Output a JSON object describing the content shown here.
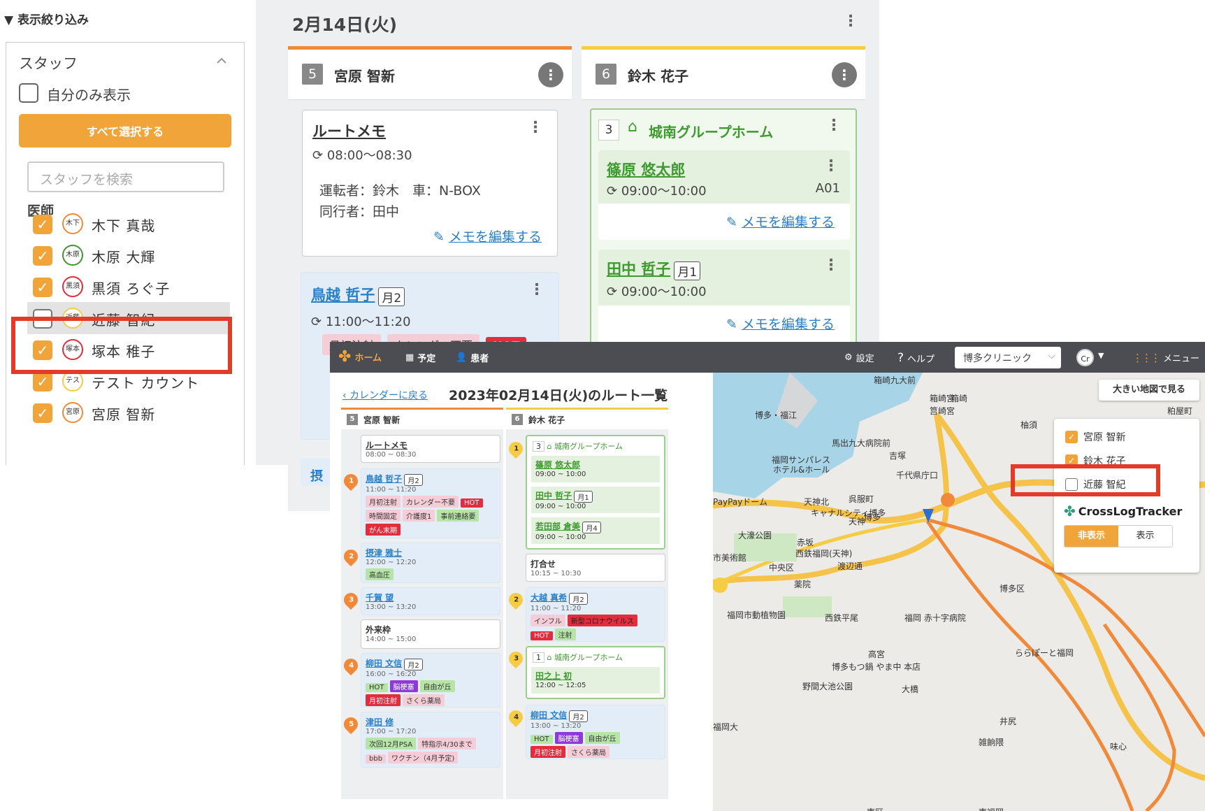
{
  "filter": {
    "header": "▼ 表示絞り込み",
    "section_title": "スタッフ",
    "self_only_label": "自分のみ表示",
    "select_all_label": "すべて選択する",
    "search_placeholder": "スタッフを検索",
    "group_label": "医師",
    "staff": [
      {
        "avatar": "木下",
        "name": "木下 真哉",
        "checked": true,
        "color": "#f08a3a"
      },
      {
        "avatar": "木原",
        "name": "木原 大輝",
        "checked": true,
        "color": "#3d9a2e"
      },
      {
        "avatar": "黒須",
        "name": "黒須 ろぐ子",
        "checked": true,
        "color": "#e32c3c"
      },
      {
        "avatar": "近藤",
        "name": "近藤 智紀",
        "checked": false,
        "color": "#f5cc44"
      },
      {
        "avatar": "塚本",
        "name": "塚本 稚子",
        "checked": true,
        "color": "#e32c3c"
      },
      {
        "avatar": "テス",
        "name": "テスト カウント",
        "checked": true,
        "color": "#f5cc44"
      },
      {
        "avatar": "宮原",
        "name": "宮原 智新",
        "checked": true,
        "color": "#f08a3a"
      }
    ]
  },
  "schedule": {
    "date_title": "2月14日(火)",
    "columns": [
      {
        "number": "5",
        "name": "宮原 智新",
        "accent": "#f08a3a"
      },
      {
        "number": "6",
        "name": "鈴木 花子",
        "accent": "#f5cc44"
      }
    ],
    "route_memo": {
      "title": "ルートメモ",
      "time": "08:00〜08:30",
      "driver_line": "運転者：鈴木　車：N-BOX",
      "companion_line": "同行者：田中",
      "edit_link": "メモを編集する"
    },
    "patient1": {
      "name": "鳥越 哲子",
      "badge": "月2",
      "time": "11:00〜11:20",
      "tags": [
        "月初注射",
        "カレンダー不要",
        "HOT"
      ]
    },
    "group_home": {
      "count": "3",
      "title": "城南グループホーム",
      "p1_name": "篠原 悠太郎",
      "p1_time": "09:00〜10:00",
      "p1_room": "A01",
      "edit_link": "メモを編集する",
      "p2_name": "田中 哲子",
      "p2_badge": "月1",
      "p2_time": "09:00〜10:00",
      "edit_link2": "メモを編集する"
    },
    "peek_text": "摂"
  },
  "app": {
    "nav": {
      "home": "ホーム",
      "schedule": "予定",
      "patients": "患者",
      "settings": "設定",
      "help": "ヘルプ",
      "clinic": "博多クリニック",
      "avatar": "Cr",
      "menu": "メニュー"
    },
    "back_link": "カレンダーに戻る",
    "route_title": "2023年02月14日(火)のルート一覧",
    "col1": {
      "number": "5",
      "name": "宮原 智新"
    },
    "col2": {
      "number": "6",
      "name": "鈴木 花子"
    },
    "c1": {
      "memo_title": "ルートメモ",
      "memo_time": "08:00 ~ 08:30",
      "p1": {
        "pin": "1",
        "name": "鳥越 哲子",
        "badge": "月2",
        "time": "11:00 ~ 11:20",
        "tags": [
          "月初注射",
          "カレンダー不要",
          "HOT",
          "時間固定",
          "介護度1",
          "事前連絡要",
          "がん末期"
        ]
      },
      "p2": {
        "pin": "2",
        "name": "摂津 雅士",
        "time": "12:00 ~ 12:20",
        "tags": [
          "高血圧"
        ]
      },
      "p3": {
        "pin": "3",
        "name": "千賀 望",
        "time": "13:00 ~ 13:20"
      },
      "ext": {
        "name": "外来枠",
        "time": "14:00 ~ 15:00"
      },
      "p4": {
        "pin": "4",
        "name": "柳田 文信",
        "badge": "月2",
        "time": "16:00 ~ 16:20",
        "tags": [
          "HOT",
          "脳梗塞",
          "自由が丘",
          "月初注射",
          "さくら薬局"
        ]
      },
      "p5": {
        "pin": "5",
        "name": "津田 修",
        "time": "17:00 ~ 17:20",
        "tags": [
          "次回12月PSA",
          "特指示4/30まで",
          "bbb",
          "ワクチン（4月予定)"
        ]
      }
    },
    "c2": {
      "g1": {
        "pin": "1",
        "count": "3",
        "title": "城南グループホーム",
        "p1": {
          "name": "篠原 悠太郎",
          "time": "09:00 ~ 10:00"
        },
        "p2": {
          "name": "田中 哲子",
          "badge": "月1",
          "time": "09:00 ~ 10:00"
        },
        "p3": {
          "name": "若田部 倉美",
          "badge": "月4",
          "time": "09:00 ~ 10:00"
        }
      },
      "meet": {
        "name": "打合せ",
        "time": "10:15 ~ 10:30"
      },
      "p2": {
        "pin": "2",
        "name": "大越 真希",
        "badge": "月2",
        "time": "11:00 ~ 11:20",
        "tags": [
          "インフル",
          "新型コロナウイルス",
          "HOT",
          "注射"
        ]
      },
      "g2": {
        "pin": "3",
        "count": "1",
        "title": "城南グループホーム",
        "p1": {
          "name": "田之上 初",
          "time": "12:00 ~ 12:05"
        }
      },
      "p4": {
        "pin": "4",
        "name": "柳田 文信",
        "badge": "月2",
        "time": "13:00 ~ 13:20",
        "tags": [
          "HOT",
          "脳梗塞",
          "自由が丘",
          "月初注射",
          "さくら薬局"
        ]
      }
    },
    "map": {
      "big_map_button": "大きい地図で見る",
      "layers": [
        {
          "name": "宮原 智新",
          "checked": true
        },
        {
          "name": "鈴木 花子",
          "checked": true
        },
        {
          "name": "近藤 智紀",
          "checked": false
        }
      ],
      "tracker_logo": "CrossLogTracker",
      "hide_label": "非表示",
      "show_label": "表示",
      "labels": [
        "箱崎九大前",
        "箱崎宮",
        "筥崎宮",
        "箱崎",
        "粕屋町",
        "柚須",
        "博多・福江",
        "福岡サンパレス",
        "ホテル&ホール",
        "馬出九大病院前",
        "吉塚",
        "千代県庁口",
        "PayPayドーム",
        "天神北",
        "呉服町",
        "キャナルシティ博多",
        "大濠公園",
        "赤坂",
        "天神",
        "博多",
        "西鉄福岡(天神)",
        "渡辺通",
        "中央区",
        "薬院",
        "市美術館",
        "福岡市動植物園",
        "西鉄平尾",
        "福岡 赤十字病院",
        "博多区",
        "ららぽーと福岡",
        "高宮",
        "博多もつ鍋 やま中 本店",
        "野間大池公園",
        "大橋",
        "井尻",
        "雑餉隈",
        "味心",
        "福岡大",
        "南区",
        "南福岡"
      ]
    }
  }
}
